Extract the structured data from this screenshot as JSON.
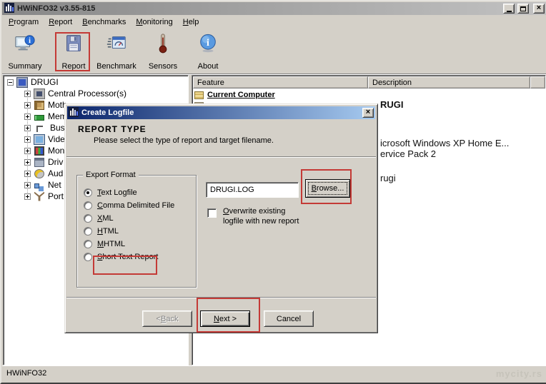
{
  "window": {
    "title": "HWiNFO32 v3.55-815"
  },
  "menu": {
    "items": [
      {
        "label": "Program",
        "underline": "P"
      },
      {
        "label": "Report",
        "underline": "R"
      },
      {
        "label": "Benchmarks",
        "underline": "B"
      },
      {
        "label": "Monitoring",
        "underline": "M"
      },
      {
        "label": "Help",
        "underline": "H"
      }
    ]
  },
  "toolbar": {
    "items": [
      {
        "label": "Summary"
      },
      {
        "label": "Report"
      },
      {
        "label": "Benchmark"
      },
      {
        "label": "Sensors"
      },
      {
        "label": "About"
      }
    ]
  },
  "tree": {
    "root": "DRUGI",
    "items": [
      "Central Processor(s)",
      "Moth",
      "Mem",
      "Bus",
      "Vide",
      "Mon",
      "Driv",
      "Aud",
      "Net",
      "Port"
    ]
  },
  "feature_panel": {
    "columns": [
      "Feature",
      "Description"
    ],
    "feature_rows": [
      "Current Computer"
    ],
    "description_lines": [
      "RUGI",
      "icrosoft Windows XP Home E...",
      "ervice Pack 2",
      "rugi"
    ]
  },
  "dialog": {
    "title": "Create Logfile",
    "heading": "REPORT TYPE",
    "subheading": "Please select the type of report and target filename.",
    "group_label": "Export Format",
    "radios": [
      {
        "label": "Text Logfile",
        "underline": "T",
        "selected": true
      },
      {
        "label": "Comma Delimited File",
        "underline": "C",
        "selected": false
      },
      {
        "label": "XML",
        "underline": "X",
        "selected": false
      },
      {
        "label": "HTML",
        "underline": "H",
        "selected": false
      },
      {
        "label": "MHTML",
        "underline": "M",
        "selected": false
      },
      {
        "label": "Short Text Report",
        "underline": "S",
        "selected": false
      }
    ],
    "filename": {
      "value": "DRUGI.LOG"
    },
    "browse": {
      "label": "Browse...",
      "underline": "B"
    },
    "overwrite": {
      "line1": {
        "label": "Overwrite existing",
        "underline": "O"
      },
      "line2": "logfile with new report",
      "checked": false
    },
    "buttons": {
      "back": {
        "label": "< Back",
        "underline": "B"
      },
      "next": {
        "label": "Next >",
        "underline": "N"
      },
      "cancel": {
        "label": "Cancel"
      }
    }
  },
  "status_bar": {
    "text": "HWiNFO32",
    "watermark": "mycity.rs"
  },
  "colors": {
    "face": "#d4d0c8",
    "accent_red": "#c43a36",
    "dialog_title_from": "#0a246a",
    "dialog_title_to": "#a6caf0",
    "inactive_title_from": "#878787",
    "inactive_title_to": "#c2c2c2"
  }
}
